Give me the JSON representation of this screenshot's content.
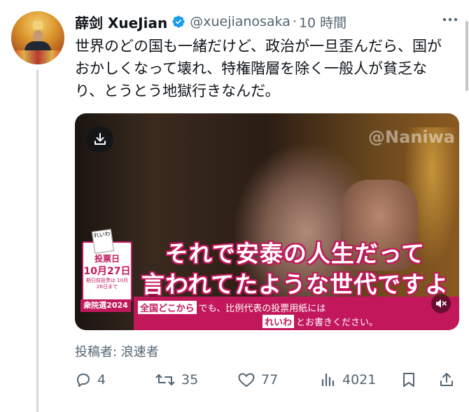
{
  "tweet": {
    "display_name": "薛剑 XueJian",
    "handle": "@xuejianosaka",
    "separator": "·",
    "time": "10 時間",
    "text": "世界のどの国も一緒だけど、政治が一旦歪んだら、国がおかしくなって壊れ、特権階層を除く一般人が貧乏なり、とうとう地獄行きなんだ。",
    "verified_color": "#1d9bf0"
  },
  "media": {
    "watermark": "@Naniwa",
    "subtitle_line1": "それで安泰の人生だって",
    "subtitle_line2": "言われてたような世代ですよ",
    "ballot_paper": "れいわ",
    "ballot_label": "投票日",
    "ballot_date": "10月27日",
    "ballot_note": "期日前投票は 10月26日まで",
    "ballot_tag": "衆院選2024",
    "banner_highlight": "全国どこから",
    "banner_text_1": "でも、比例代表の投票用紙には",
    "banner_highlight_2": "れいわ",
    "banner_text_2": "とお書きください。",
    "accent_color": "#c2185b",
    "download_icon": "download-icon",
    "mute_icon": "volume-mute-icon"
  },
  "community_note": "投稿者: 浪速者",
  "actions": {
    "replies": "4",
    "reposts": "35",
    "likes": "77",
    "views": "4021"
  }
}
